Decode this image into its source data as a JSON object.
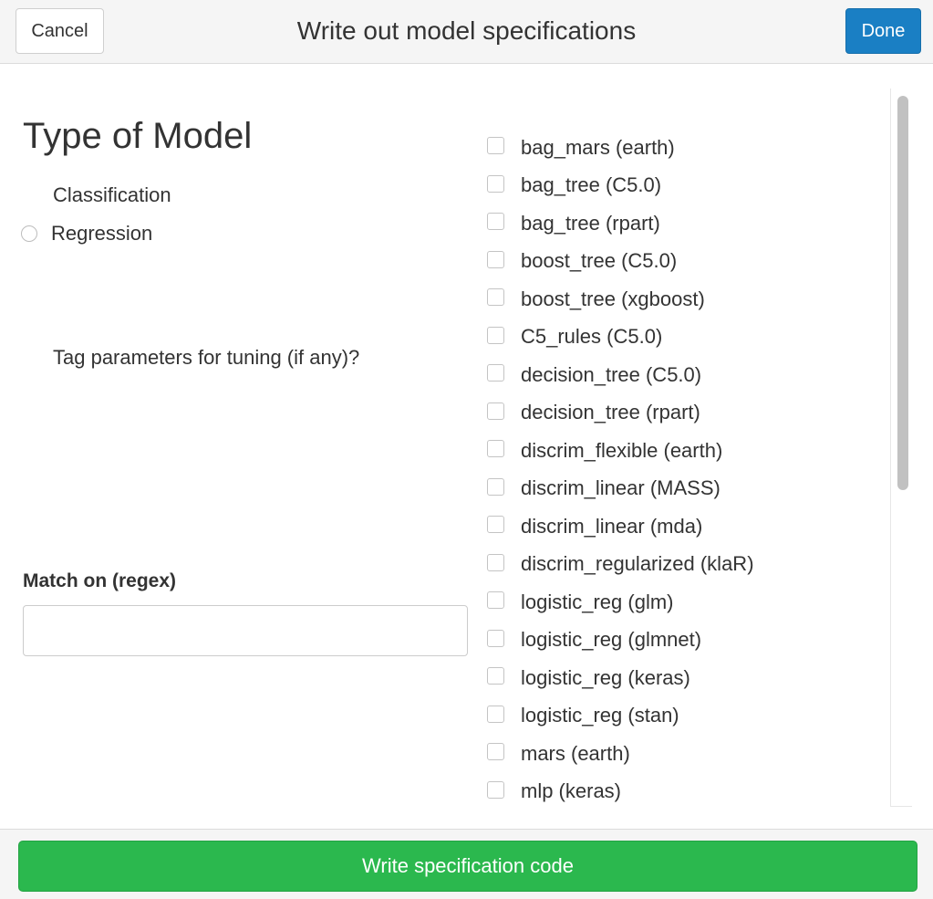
{
  "header": {
    "cancel_label": "Cancel",
    "title": "Write out model specifications",
    "done_label": "Done"
  },
  "left": {
    "section_title": "Type of Model",
    "radio_options": [
      {
        "label": "Classification",
        "selected": true
      },
      {
        "label": "Regression",
        "selected": false
      }
    ],
    "tag_label": "Tag parameters for tuning (if any)?",
    "match_label": "Match on (regex)",
    "match_value": ""
  },
  "models": [
    "bag_mars (earth)",
    "bag_tree (C5.0)",
    "bag_tree (rpart)",
    "boost_tree (C5.0)",
    "boost_tree (xgboost)",
    "C5_rules (C5.0)",
    "decision_tree (C5.0)",
    "decision_tree (rpart)",
    "discrim_flexible (earth)",
    "discrim_linear (MASS)",
    "discrim_linear (mda)",
    "discrim_regularized (klaR)",
    "logistic_reg (glm)",
    "logistic_reg (glmnet)",
    "logistic_reg (keras)",
    "logistic_reg (stan)",
    "mars (earth)",
    "mlp (keras)"
  ],
  "footer": {
    "write_label": "Write specification code"
  },
  "colors": {
    "done_button": "#1a7fc4",
    "write_button": "#2bb84e"
  }
}
